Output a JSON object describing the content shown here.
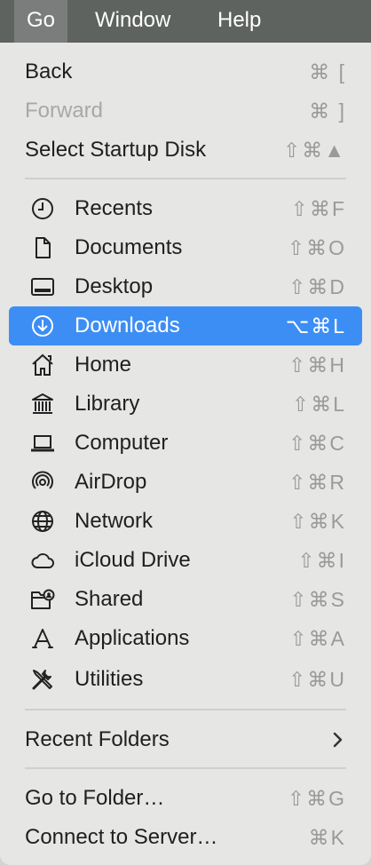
{
  "menubar": {
    "go": "Go",
    "window": "Window",
    "help": "Help"
  },
  "menu": {
    "back": {
      "label": "Back",
      "shortcut": "⌘ ["
    },
    "forward": {
      "label": "Forward",
      "shortcut": "⌘ ]"
    },
    "startup": {
      "label": "Select Startup Disk",
      "shortcut": "⇧⌘▲"
    },
    "places": [
      {
        "label": "Recents",
        "shortcut": "⇧⌘F",
        "icon": "clock-icon"
      },
      {
        "label": "Documents",
        "shortcut": "⇧⌘O",
        "icon": "document-icon"
      },
      {
        "label": "Desktop",
        "shortcut": "⇧⌘D",
        "icon": "desktop-icon"
      },
      {
        "label": "Downloads",
        "shortcut": "⌥⌘L",
        "icon": "download-icon"
      },
      {
        "label": "Home",
        "shortcut": "⇧⌘H",
        "icon": "home-icon"
      },
      {
        "label": "Library",
        "shortcut": "⇧⌘L",
        "icon": "library-icon"
      },
      {
        "label": "Computer",
        "shortcut": "⇧⌘C",
        "icon": "laptop-icon"
      },
      {
        "label": "AirDrop",
        "shortcut": "⇧⌘R",
        "icon": "airdrop-icon"
      },
      {
        "label": "Network",
        "shortcut": "⇧⌘K",
        "icon": "globe-icon"
      },
      {
        "label": "iCloud Drive",
        "shortcut": "⇧⌘I",
        "icon": "cloud-icon"
      },
      {
        "label": "Shared",
        "shortcut": "⇧⌘S",
        "icon": "shared-folder-icon"
      },
      {
        "label": "Applications",
        "shortcut": "⇧⌘A",
        "icon": "applications-icon"
      },
      {
        "label": "Utilities",
        "shortcut": "⇧⌘U",
        "icon": "utilities-icon"
      }
    ],
    "recent_folders": {
      "label": "Recent Folders"
    },
    "go_to_folder": {
      "label": "Go to Folder…",
      "shortcut": "⇧⌘G"
    },
    "connect": {
      "label": "Connect to Server…",
      "shortcut": "⌘K"
    }
  },
  "colors": {
    "highlight": "#3d8ef4",
    "menubar": "#5f6360",
    "menu_bg": "#e6e6e5"
  }
}
